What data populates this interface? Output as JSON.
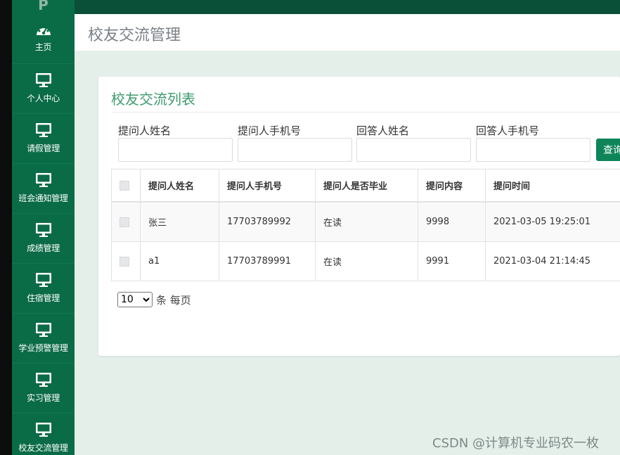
{
  "page_title": "校友交流管理",
  "brand_glyph": "P",
  "sidebar": {
    "items": [
      {
        "label": "主页",
        "icon": "dashboard-icon"
      },
      {
        "label": "个人中心",
        "icon": "monitor-icon"
      },
      {
        "label": "请假管理",
        "icon": "monitor-icon"
      },
      {
        "label": "班会通知管理",
        "icon": "monitor-icon"
      },
      {
        "label": "成绩管理",
        "icon": "monitor-icon"
      },
      {
        "label": "住宿管理",
        "icon": "monitor-icon"
      },
      {
        "label": "学业预警管理",
        "icon": "monitor-icon"
      },
      {
        "label": "实习管理",
        "icon": "monitor-icon"
      },
      {
        "label": "校友交流管理",
        "icon": "monitor-icon"
      }
    ]
  },
  "card": {
    "title": "校友交流列表",
    "filters": [
      {
        "label": "提问人姓名",
        "value": ""
      },
      {
        "label": "提问人手机号",
        "value": ""
      },
      {
        "label": "回答人姓名",
        "value": ""
      },
      {
        "label": "回答人手机号",
        "value": ""
      }
    ],
    "query_label": "查询"
  },
  "table": {
    "headers": [
      "提问人姓名",
      "提问人手机号",
      "提问人是否毕业",
      "提问内容",
      "提问时间"
    ],
    "rows": [
      [
        "张三",
        "17703789992",
        "在读",
        "9998",
        "2021-03-05 19:25:01"
      ],
      [
        "a1",
        "17703789991",
        "在读",
        "9991",
        "2021-03-04 21:14:45"
      ]
    ]
  },
  "pager": {
    "page_size": "10",
    "options": [
      "10"
    ],
    "suffix": "条 每页"
  },
  "watermark": "CSDN @计算机专业码农一枚",
  "colors": {
    "sidebar": "#0a6b47",
    "topbar": "#0a4f37",
    "accent": "#3c9b6b",
    "button": "#0d8559",
    "content_bg": "#e4efea"
  }
}
